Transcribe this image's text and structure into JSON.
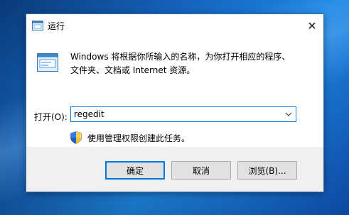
{
  "window": {
    "title": "运行",
    "close_glyph": "✕"
  },
  "main": {
    "description_line1": "Windows 将根据你所输入的名称，为你打开相应的程序、",
    "description_line2": "文件夹、文档或 Internet 资源。",
    "open_label": "打开(O):",
    "open_value": "regedit",
    "admin_note": "使用管理权限创建此任务。"
  },
  "buttons": {
    "ok": "确定",
    "cancel": "取消",
    "browse": "浏览(B)..."
  },
  "icons": {
    "title": "run-icon",
    "dialog": "run-icon",
    "admin": "uac-shield-icon",
    "dropdown": "chevron-down-icon",
    "close": "close-icon"
  },
  "colors": {
    "accent": "#0078d7",
    "footer_bg": "#f0f0f0",
    "button_bg": "#e1e1e1"
  }
}
